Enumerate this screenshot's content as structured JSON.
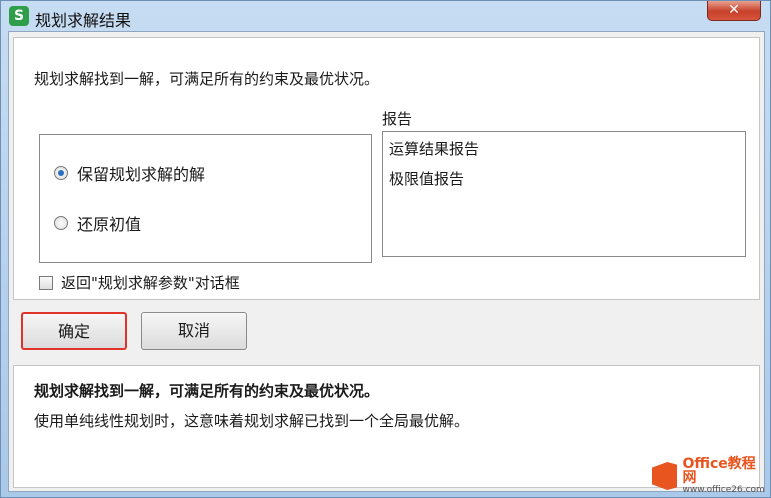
{
  "window": {
    "title": "规划求解结果",
    "app_icon_letter": "S",
    "close_glyph": "✕"
  },
  "dialog": {
    "message": "规划求解找到一解，可满足所有的约束及最优状况。",
    "options": [
      {
        "label": "保留规划求解的解",
        "selected": true
      },
      {
        "label": "还原初值",
        "selected": false
      }
    ],
    "report_label": "报告",
    "reports": [
      "运算结果报告",
      "极限值报告"
    ],
    "return_checkbox_label": "返回\"规划求解参数\"对话框",
    "return_checkbox_checked": false,
    "ok_label": "确定",
    "cancel_label": "取消"
  },
  "info": {
    "title": "规划求解找到一解，可满足所有的约束及最优状况。",
    "description": "使用单纯线性规划时，这意味着规划求解已找到一个全局最优解。"
  },
  "watermark": {
    "main": "Office教程网",
    "sub": "www.office26.com"
  },
  "colors": {
    "ok_highlight": "#e0332b",
    "app_icon": "#2e9e4a",
    "radio_dot": "#2b6fc2",
    "watermark": "#e8551f"
  }
}
